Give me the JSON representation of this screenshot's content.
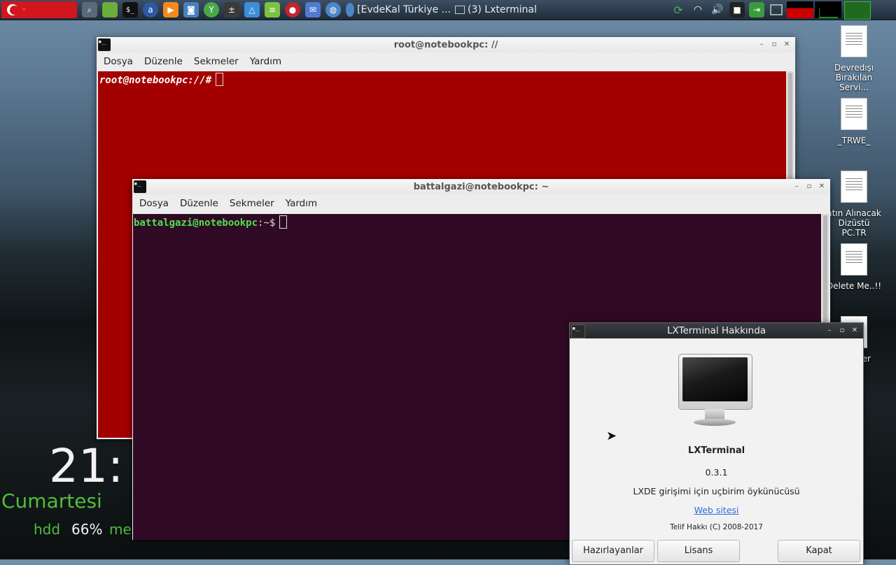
{
  "taskbar": {
    "tasks": [
      "[EvdeKal Türkiye ...",
      "(3) Lxterminal"
    ]
  },
  "root_terminal": {
    "title": "root@notebookpc: //",
    "menu": [
      "Dosya",
      "Düzenle",
      "Sekmeler",
      "Yardım"
    ],
    "prompt": "root@notebookpc://#",
    "bg": "#a30000"
  },
  "user_terminal": {
    "title": "battalgazi@notebookpc: ~",
    "menu": [
      "Dosya",
      "Düzenle",
      "Sekmeler",
      "Yardım"
    ],
    "prompt_user": "battalgazi@notebookpc",
    "prompt_path": ":~",
    "prompt_symbol": "$",
    "bg": "#300a24"
  },
  "about_dialog": {
    "title": "LXTerminal Hakkında",
    "app_name": "LXTerminal",
    "version": "0.3.1",
    "description": "LXDE girişimi için uçbirim öykünücüsü",
    "website": "Web sitesi",
    "copyright": "Telif Hakkı (C) 2008-2017",
    "buttons": {
      "credits": "Hazırlayanlar",
      "license": "Lisans",
      "close": "Kapat"
    }
  },
  "desktop_icons": [
    {
      "label": "Devredışı Bırakılan Servi..."
    },
    {
      "label": "_TRWE_"
    },
    {
      "label": "atın Alınacak Dizüstü PC.TR"
    },
    {
      "label": "Delete Me..!!"
    },
    {
      "label": "er"
    }
  ],
  "conky": {
    "time": "21:",
    "day": "Cumartesi",
    "hdd_label": "hdd",
    "hdd_value": "66%",
    "mem_label": "me"
  }
}
